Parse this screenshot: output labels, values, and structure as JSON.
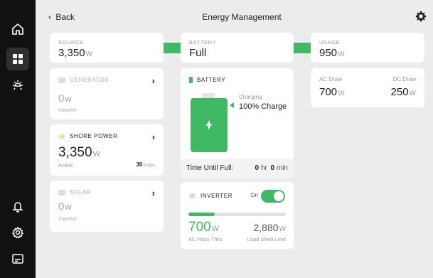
{
  "header": {
    "back_label": "Back",
    "title": "Energy Management"
  },
  "flow": {
    "source": {
      "caption": "SOURCE",
      "value": "3,350",
      "unit": "W"
    },
    "battery": {
      "caption": "BATTERY",
      "value": "Full"
    },
    "usage": {
      "caption": "USAGE",
      "value": "950",
      "unit": "W"
    }
  },
  "generator": {
    "label": "GENERATOR",
    "value": "0",
    "unit": "W",
    "status": "Inactive"
  },
  "shore_power": {
    "label": "SHORE POWER",
    "value": "3,350",
    "unit": "W",
    "status": "Active",
    "amps_value": "30",
    "amps_unit": "Amps"
  },
  "solar": {
    "label": "SOLAR",
    "value": "0",
    "unit": "W",
    "status": "Inactive"
  },
  "battery_card": {
    "label": "BATTERY",
    "state": "Charging",
    "charge_text": "100% Charge",
    "charge_level": 1.0,
    "time_label": "Time Until Full:",
    "hr_value": "0",
    "hr_unit": "hr",
    "min_value": "0",
    "min_unit": "min"
  },
  "inverter": {
    "label": "INVERTER",
    "toggle_label": "On",
    "is_on": true,
    "load_fraction": 0.27,
    "pass_value": "700",
    "pass_unit": "W",
    "pass_label": "AC Pass-Thru",
    "limit_value": "2,880",
    "limit_unit": "W",
    "limit_label": "Load Shed Limit"
  },
  "draw": {
    "ac_label": "AC Draw",
    "ac_value": "700",
    "ac_unit": "W",
    "dc_label": "DC Draw",
    "dc_value": "250",
    "dc_unit": "W"
  },
  "icons": {
    "rail": [
      "home-icon",
      "dashboard-icon",
      "lights-icon",
      "bell-icon",
      "settings-cog-icon",
      "display-icon"
    ],
    "accent_color": "#3fb964"
  }
}
